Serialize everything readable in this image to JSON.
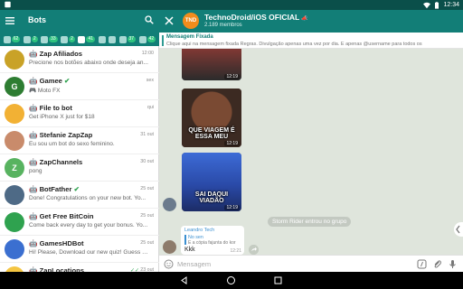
{
  "status_bar": {
    "time": "12:34"
  },
  "left_panel": {
    "title": "Bots",
    "filters": [
      {
        "icon": "all-chats-icon",
        "count": "62"
      },
      {
        "icon": "users-icon",
        "count": "2"
      },
      {
        "icon": "groups-icon",
        "count": "33"
      },
      {
        "icon": "channels-icon",
        "count": "2"
      },
      {
        "icon": "bots-icon",
        "count": "41"
      },
      {
        "icon": "saved-icon",
        "count": ""
      },
      {
        "icon": "star-icon",
        "count": ""
      },
      {
        "icon": "admin-icon",
        "count": "37"
      },
      {
        "icon": "unread-icon",
        "count": "42"
      }
    ],
    "chats": [
      {
        "name": "Zap Afiliados",
        "time": "12:00",
        "preview": "Precione nos botões abaixo onde deseja an...",
        "avatar_color": "#c9a227",
        "avatar_text": ""
      },
      {
        "name": "Gamee",
        "time": "sex",
        "preview": "Moto FX",
        "avatar_color": "#2e7d32",
        "avatar_text": "G"
      },
      {
        "name": "File to bot",
        "time": "qui",
        "preview": "Get iPhone X just for $18",
        "avatar_color": "#f2b134",
        "avatar_text": ""
      },
      {
        "name": "Stefanie ZapZap",
        "time": "31 out",
        "preview": "Eu sou um bot do sexo feminino.",
        "avatar_color": "#c98b6b",
        "avatar_text": ""
      },
      {
        "name": "ZapChannels",
        "time": "30 out",
        "preview": "pong",
        "avatar_color": "#58b360",
        "avatar_text": "Z"
      },
      {
        "name": "BotFather",
        "time": "25 out",
        "preview": "Done! Congratulations on your new bot. Yo...",
        "avatar_color": "#4e6a86",
        "avatar_text": ""
      },
      {
        "name": "Get Free BitCoin",
        "time": "25 out",
        "preview": "Come back every day to get your bonus. Yo...",
        "avatar_color": "#2fa24f",
        "avatar_text": ""
      },
      {
        "name": "GamesHDBot",
        "time": "25 out",
        "preview": "Hi! Please, Download our new quiz! Guess w...",
        "avatar_color": "#3b6fd0",
        "avatar_text": ""
      },
      {
        "name": "ZapLocations",
        "time": "23 out",
        "preview": "",
        "avatar_color": "#f4c542",
        "avatar_text": ""
      }
    ]
  },
  "right_panel": {
    "group_name": "TechnoDroid/iOS OFICIAL",
    "group_avatar_text": "TND",
    "members": "2.189 membros",
    "pinned_title": "Mensagem Fixada",
    "pinned_text": "Clique aqui na mensagem fixada Regras. Divulgação apenas uma vez por dia. E apenas @username para todos os",
    "stickers": [
      {
        "caption": "",
        "time": "12:19"
      },
      {
        "caption": "QUE VIAGEM É ESSA MEU",
        "time": "12:19"
      },
      {
        "caption": "SAI DAQUI VIADÃO",
        "time": "12:19"
      }
    ],
    "system_message": "Storm Rider entrou no grupo",
    "reply": {
      "sender": "Leandro Tech",
      "quoted_title": "No sen",
      "quoted_text": "E a cópia fajunta do kor",
      "text": "Kkk",
      "time": "12:21"
    },
    "input_placeholder": "Mensagem"
  }
}
